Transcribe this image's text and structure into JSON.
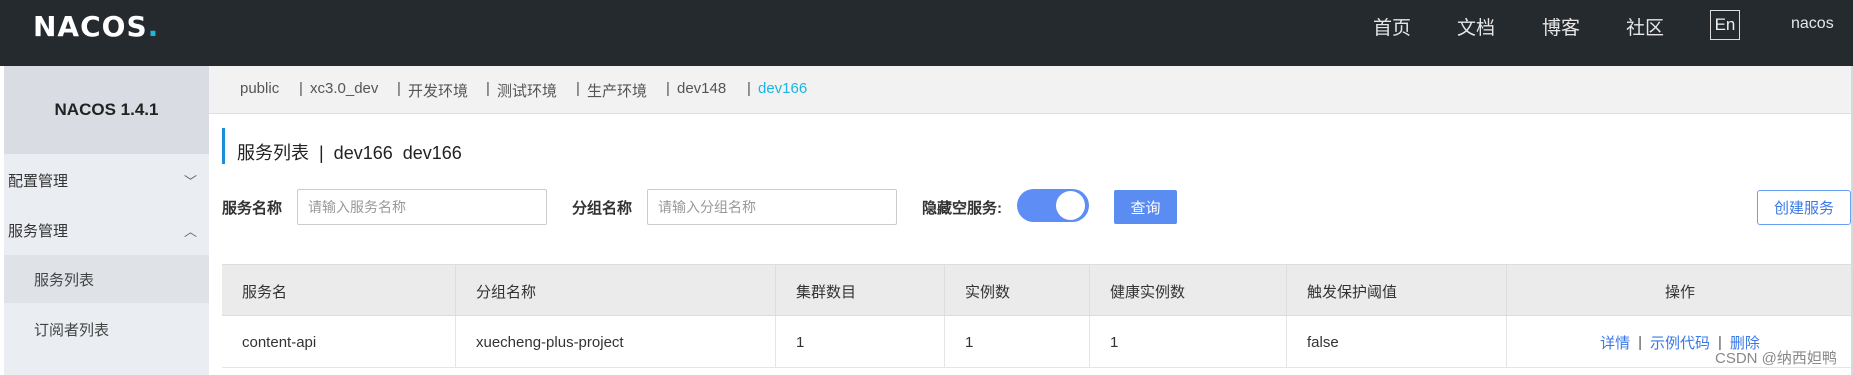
{
  "header": {
    "logo_text": "NACOS",
    "logo_dot": ".",
    "nav": [
      "首页",
      "文档",
      "博客",
      "社区"
    ],
    "lang": "En",
    "user": "nacos"
  },
  "sidebar": {
    "version": "NACOS 1.4.1",
    "groups": [
      {
        "label": "配置管理",
        "arrow": "﹀"
      },
      {
        "label": "服务管理",
        "arrow": "︿"
      }
    ],
    "subitems": [
      "服务列表",
      "订阅者列表"
    ]
  },
  "namespaces": [
    "public",
    "xc3.0_dev",
    "开发环境",
    "测试环境",
    "生产环境",
    "dev148",
    "dev166"
  ],
  "ns_separator": "|",
  "title": "服务列表  |  dev166  dev166",
  "filters": {
    "service_name_label": "服务名称",
    "service_name_placeholder": "请输入服务名称",
    "group_name_label": "分组名称",
    "group_name_placeholder": "请输入分组名称",
    "hide_empty_label": "隐藏空服务:",
    "hide_empty_on": true,
    "query_label": "查询",
    "create_label": "创建服务"
  },
  "table": {
    "columns": [
      "服务名",
      "分组名称",
      "集群数目",
      "实例数",
      "健康实例数",
      "触发保护阈值",
      "操作"
    ],
    "rows": [
      {
        "cells": [
          "content-api",
          "xuecheng-plus-project",
          "1",
          "1",
          "1",
          "false"
        ],
        "actions": [
          "详情",
          "示例代码",
          "删除"
        ]
      }
    ]
  },
  "watermark": "CSDN @纳西妲鸭",
  "colors": {
    "header_bg": "#252a2f",
    "accent": "#1cb6e0",
    "primary_button": "#5a8cf2",
    "link": "#3a78e8"
  }
}
